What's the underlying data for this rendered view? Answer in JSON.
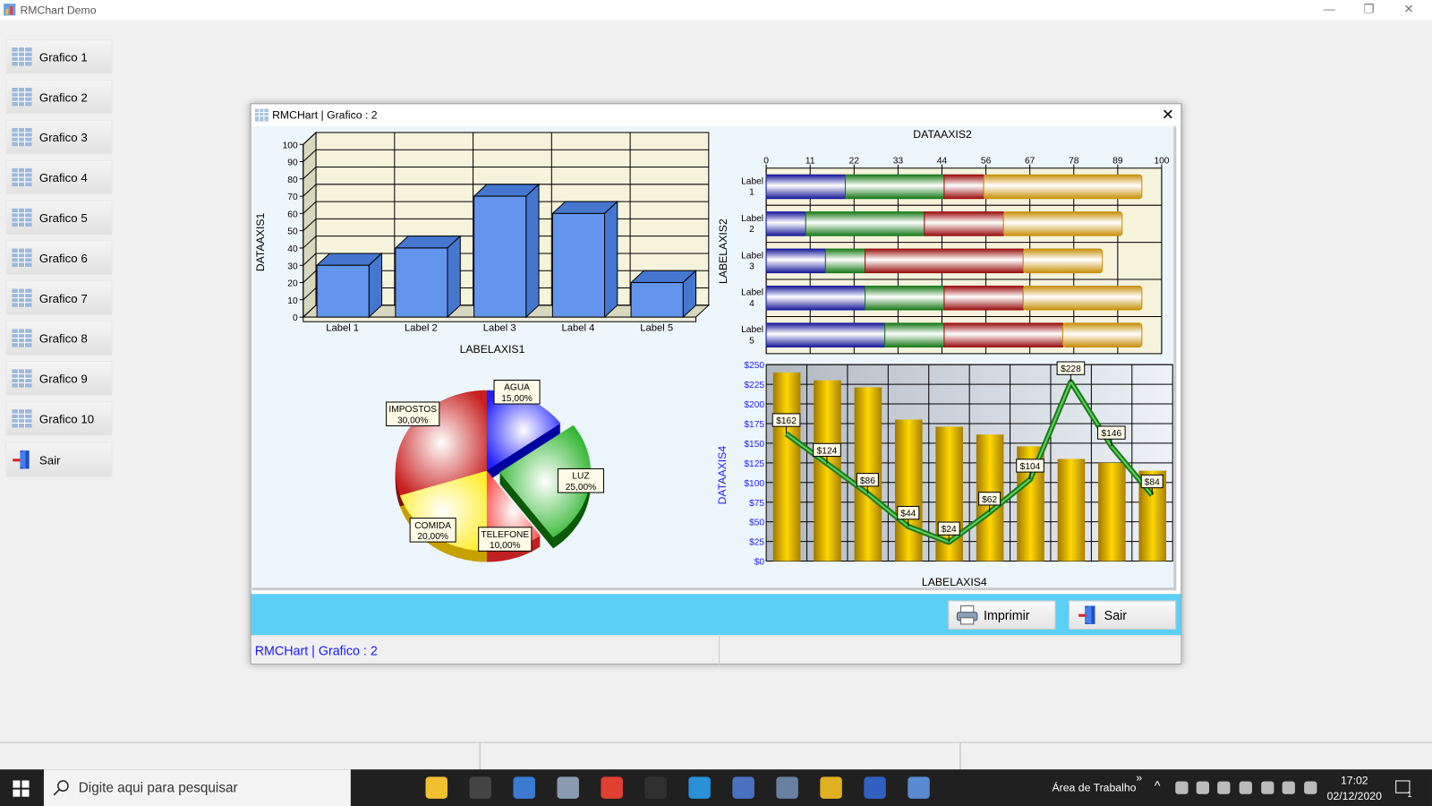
{
  "app": {
    "title": "RMChart Demo"
  },
  "sidebar": {
    "items": [
      {
        "label": "Grafico 1"
      },
      {
        "label": "Grafico 2"
      },
      {
        "label": "Grafico 3"
      },
      {
        "label": "Grafico 4"
      },
      {
        "label": "Grafico 5"
      },
      {
        "label": "Grafico 6"
      },
      {
        "label": "Grafico 7"
      },
      {
        "label": "Grafico 8"
      },
      {
        "label": "Grafico 9"
      },
      {
        "label": "Grafico 10"
      }
    ],
    "exit_label": "Sair"
  },
  "dialog": {
    "title": "RMCHart | Grafico : 2",
    "print_label": "Imprimir",
    "exit_label": "Sair",
    "status_text": "RMCHart | Grafico : 2"
  },
  "taskbar": {
    "search_placeholder": "Digite aqui para pesquisar",
    "desktop_label": "Área de Trabalho",
    "chevron": "»",
    "time": "17:02",
    "date": "02/12/2020",
    "notification_count": "1"
  },
  "colors": {
    "bar3d": "#6495ed",
    "bar3d_dark": "#4577cf",
    "cyan_band": "#5bd0f7",
    "gold": "#ffd700",
    "line": "#2e9e2e",
    "status_text": "#1a1aff"
  },
  "chart_data": [
    {
      "type": "bar",
      "title": "",
      "categories": [
        "Label 1",
        "Label 2",
        "Label 3",
        "Label 4",
        "Label 5"
      ],
      "values": [
        30,
        40,
        70,
        60,
        20
      ],
      "xlabel": "LABELAXIS1",
      "ylabel": "DATAAXIS1",
      "ylim": [
        0,
        100
      ],
      "yticks": [
        "0",
        "10",
        "20",
        "30",
        "40",
        "50",
        "60",
        "70",
        "80",
        "90",
        "100"
      ],
      "style": "3d"
    },
    {
      "type": "bar",
      "orientation": "horizontal",
      "stacked": true,
      "xlabel": "DATAAXIS2",
      "ylabel": "LABELAXIS2",
      "categories": [
        [
          "Label",
          "1"
        ],
        [
          "Label",
          "2"
        ],
        [
          "Label",
          "3"
        ],
        [
          "Label",
          "4"
        ],
        [
          "Label",
          "5"
        ]
      ],
      "xticks": [
        "0",
        "11",
        "22",
        "33",
        "44",
        "56",
        "67",
        "78",
        "89",
        "100"
      ],
      "xlim": [
        0,
        100
      ],
      "series": [
        {
          "name": "blue",
          "color": "#1a1a9a",
          "values": [
            20,
            10,
            15,
            25,
            30
          ]
        },
        {
          "name": "green",
          "color": "#1a7a1a",
          "values": [
            25,
            30,
            10,
            20,
            15
          ]
        },
        {
          "name": "red",
          "color": "#9a1010",
          "values": [
            10,
            20,
            40,
            20,
            30
          ]
        },
        {
          "name": "gold",
          "color": "#c8900a",
          "values": [
            40,
            30,
            20,
            30,
            20
          ]
        }
      ]
    },
    {
      "type": "pie",
      "slices": [
        {
          "label": "AGUA",
          "pct": "15,00%",
          "value": 15,
          "color": "#2020ff"
        },
        {
          "label": "LUZ",
          "pct": "25,00%",
          "value": 25,
          "color": "#20b020",
          "exploded": true
        },
        {
          "label": "TELEFONE",
          "pct": "10,00%",
          "value": 10,
          "color": "#ff5050"
        },
        {
          "label": "COMIDA",
          "pct": "20,00%",
          "value": 20,
          "color": "#ffee30"
        },
        {
          "label": "IMPOSTOS",
          "pct": "30,00%",
          "value": 30,
          "color": "#c82020"
        }
      ]
    },
    {
      "type": "bar+line",
      "xlabel": "LABELAXIS4",
      "ylabel": "DATAAXIS4",
      "ylim": [
        0,
        250
      ],
      "yticks": [
        "$0",
        "$25",
        "$50",
        "$75",
        "$100",
        "$125",
        "$150",
        "$175",
        "$200",
        "$225",
        "$250"
      ],
      "bars": [
        240,
        230,
        221,
        180,
        171,
        161,
        146,
        130,
        125,
        115
      ],
      "line": [
        162,
        124,
        86,
        44,
        24,
        62,
        104,
        228,
        146,
        84
      ],
      "line_labels": [
        "$162",
        "$124",
        "$86",
        "$44",
        "$24",
        "$62",
        "$104",
        "$228",
        "$146",
        "$84"
      ]
    }
  ]
}
